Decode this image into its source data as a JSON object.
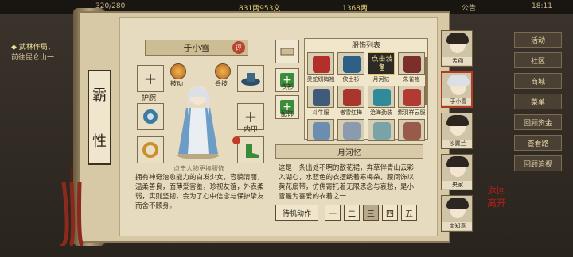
{
  "topbar": {
    "hp": "320/280",
    "money": "831两953文",
    "ingot": "1368两",
    "notice": "公告",
    "clock": "18:11"
  },
  "quest": {
    "title": "武林作局，",
    "line": "前往昆仑山一"
  },
  "right_menu": [
    {
      "label": "活动"
    },
    {
      "label": "社区"
    },
    {
      "label": "商城"
    },
    {
      "label": "菜单"
    },
    {
      "label": "回顾资金"
    },
    {
      "label": "查看路"
    },
    {
      "label": "回顾追视"
    }
  ],
  "scroll": {
    "char_name_col": [
      "霸",
      "性"
    ]
  },
  "character": {
    "name": "于小雪",
    "badge": "评",
    "hint": "点击人物更换服饰",
    "desc": "拥有神奇治愈能力的白发少女，容貌清丽，温柔善良，面薄爱害羞，珍视友谊，外表柔弱，实则坚韧，会为了心中信念与保护挚友而舍不顾身。"
  },
  "slots": {
    "left_top": "护腕",
    "right_top": "内甲"
  },
  "skills": [
    {
      "label": "被动"
    },
    {
      "label": "香技"
    }
  ],
  "side_tabs": [
    {
      "label": "衣衫"
    },
    {
      "label": "配饰"
    }
  ],
  "outfits": {
    "title": "服饰列表",
    "selected": "点击装备",
    "items": [
      {
        "label": "灵蛇绣梅袍",
        "color": "#b3302a"
      },
      {
        "label": "侠士衫",
        "color": "#2f5f86"
      },
      {
        "label": "月河忆",
        "color": "#3a6fa8"
      },
      {
        "label": "朱雀袍",
        "color": "#7a2f2a"
      },
      {
        "label": "斗牛服",
        "color": "#405b7a"
      },
      {
        "label": "傲雪红梅",
        "color": "#a9352b"
      },
      {
        "label": "沧海劲装",
        "color": "#2f8a9a"
      },
      {
        "label": "紫羽祥云服",
        "color": "#b13a33"
      },
      {
        "label": "",
        "color": "#6d8db0"
      },
      {
        "label": "",
        "color": "#8a9bb0"
      },
      {
        "label": "",
        "color": "#7aa3a8"
      },
      {
        "label": "",
        "color": "#9a5a4a"
      }
    ]
  },
  "detail": {
    "title": "月河忆",
    "desc": "这是一条出处不明的散花裙，奔草伴青山云彩入湖心，水蓝色的衣摆绣着寒梅朵，腰间饰以黄花扇带，仿佛寄托着无限思念与哀愁，是小雪最为喜爱的衣着之一"
  },
  "actions": {
    "idle": "待机动作",
    "buttons": [
      "一",
      "二",
      "三",
      "四",
      "五"
    ],
    "active_index": 2
  },
  "roster": [
    {
      "name": "孟翔"
    },
    {
      "name": "于小雪"
    },
    {
      "name": "沙翼兰"
    },
    {
      "name": "央家"
    },
    {
      "name": "南知意"
    }
  ],
  "back": {
    "line1": "返回",
    "line2": "离开"
  }
}
